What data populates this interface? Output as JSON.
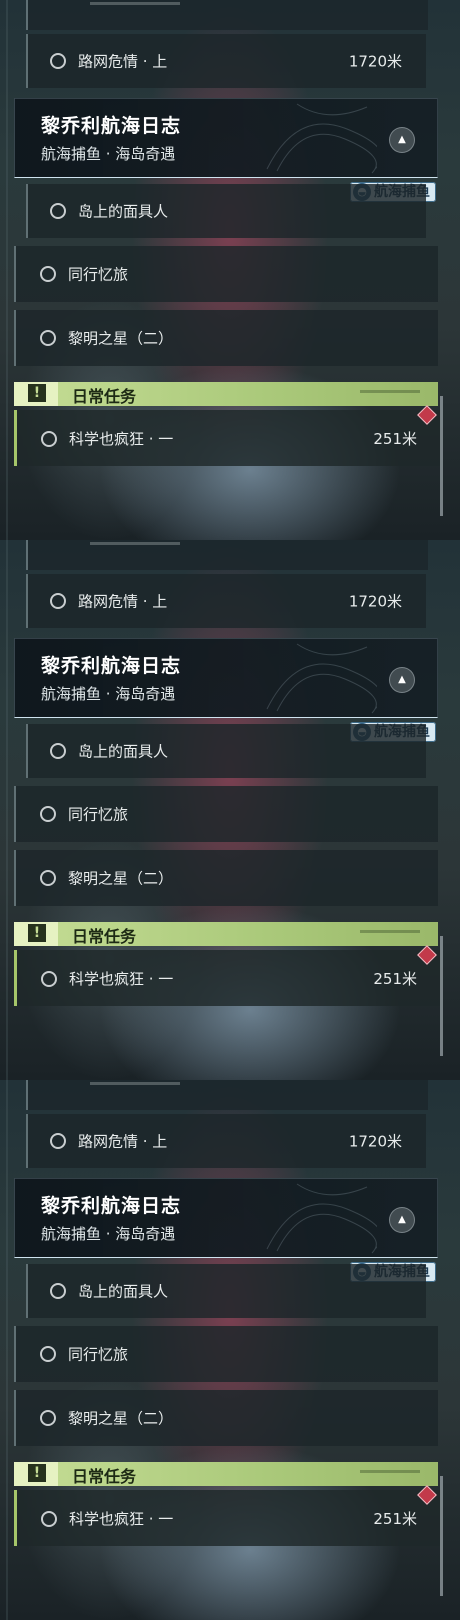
{
  "panels": [
    {
      "route_item": {
        "label": "路网危情 · 上",
        "distance": "1720米"
      },
      "header": {
        "title": "黎乔利航海日志",
        "subtitle": "航海捕鱼 · 海岛奇遇"
      },
      "tag": "航海捕鱼",
      "quests": [
        "岛上的面具人",
        "同行忆旅",
        "黎明之星（二）"
      ],
      "daily": {
        "label": "日常任务",
        "item": "科学也疯狂 · 一",
        "distance": "251米"
      }
    },
    {
      "route_item": {
        "label": "路网危情 · 上",
        "distance": "1720米"
      },
      "header": {
        "title": "黎乔利航海日志",
        "subtitle": "航海捕鱼 · 海岛奇遇"
      },
      "tag": "航海捕鱼",
      "quests": [
        "岛上的面具人",
        "同行忆旅",
        "黎明之星（二）"
      ],
      "daily": {
        "label": "日常任务",
        "item": "科学也疯狂 · 一",
        "distance": "251米"
      }
    },
    {
      "route_item": {
        "label": "路网危情 · 上",
        "distance": "1720米"
      },
      "header": {
        "title": "黎乔利航海日志",
        "subtitle": "航海捕鱼 · 海岛奇遇"
      },
      "tag": "航海捕鱼",
      "quests": [
        "岛上的面具人",
        "同行忆旅",
        "黎明之星（二）"
      ],
      "daily": {
        "label": "日常任务",
        "item": "科学也疯狂 · 一",
        "distance": "251米"
      }
    }
  ],
  "icons": {
    "collapse": "chevron-up-icon",
    "daily": "exclamation-icon",
    "tag": "fish-icon",
    "marker": "diamond-marker-icon"
  },
  "colors": {
    "daily_accent": "#c5dd95",
    "marker": "#c23a4a",
    "tag_bg": "#d8e9f2"
  }
}
